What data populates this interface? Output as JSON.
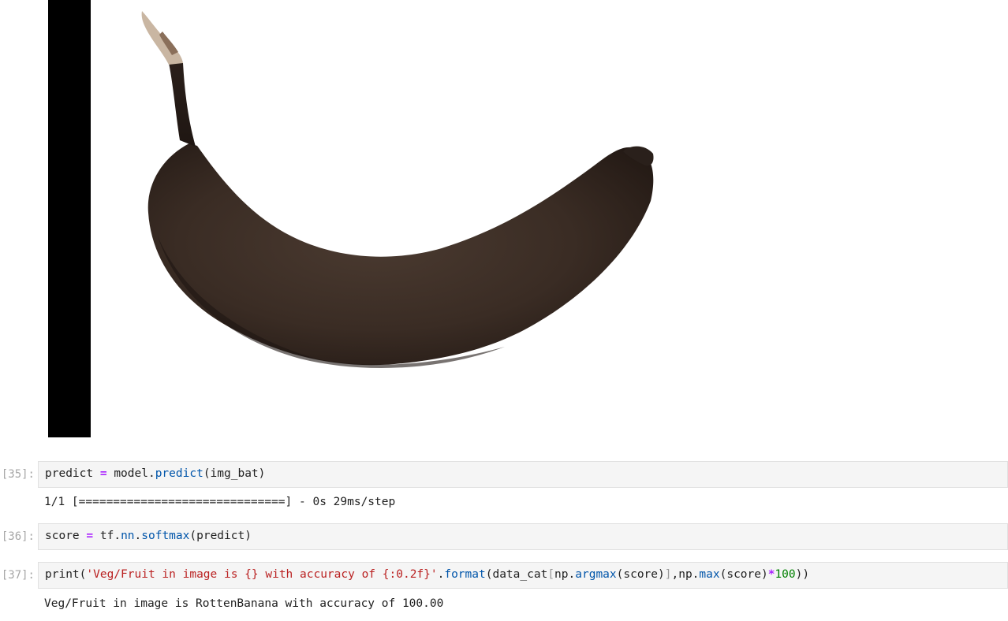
{
  "image_output": {
    "description_icon": "banana-image"
  },
  "cells": [
    {
      "prompt": "[35]:",
      "code": {
        "var": "predict",
        "op": "=",
        "obj": "model",
        "dot": ".",
        "method": "predict",
        "args": "(img_bat)"
      },
      "output": "1/1 [==============================] - 0s 29ms/step"
    },
    {
      "prompt": "[36]:",
      "code": {
        "var": "score",
        "op": "=",
        "obj1": "tf",
        "dot1": ".",
        "mod": "nn",
        "dot2": ".",
        "method": "softmax",
        "args": "(predict)"
      }
    },
    {
      "prompt": "[37]:",
      "code": {
        "fn": "print(",
        "str": "'Veg/Fruit in image is {} with accuracy of {:0.2f}'",
        "dot": ".",
        "method": "format",
        "p1": "(data_cat",
        "lb": "[",
        "np1": "np.",
        "argmax": "argmax",
        "p2": "(score)",
        "rb": "]",
        "p3": ",np.",
        "max": "max",
        "p4": "(score)",
        "mul": "*",
        "num": "100",
        "p5": "))"
      },
      "output": "Veg/Fruit in image is RottenBanana with accuracy of 100.00"
    }
  ]
}
